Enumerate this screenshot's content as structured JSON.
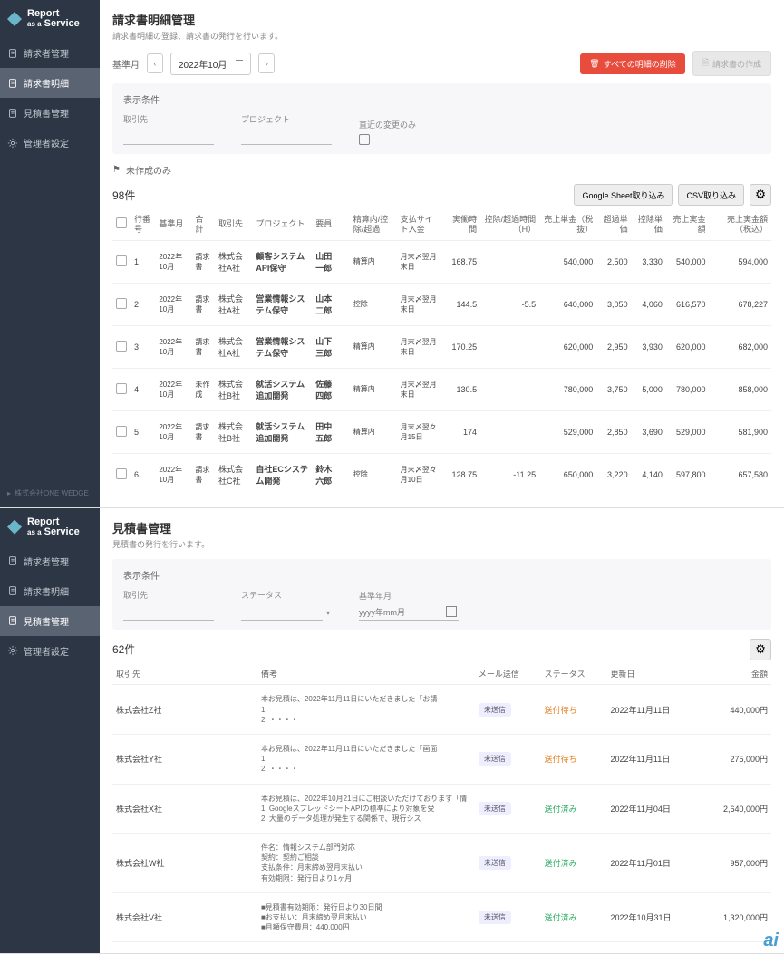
{
  "brand": {
    "line1": "Report",
    "line2": "as a",
    "line3": "Service"
  },
  "nav": [
    {
      "icon": "doc",
      "label": "請求者管理"
    },
    {
      "icon": "doc",
      "label": "請求書明細"
    },
    {
      "icon": "doc",
      "label": "見積書管理"
    },
    {
      "icon": "gear",
      "label": "管理者設定"
    }
  ],
  "footer_company": "株式会社ONE WEDGE",
  "screen1": {
    "title": "請求書明細管理",
    "subtitle": "請求書明細の登録、請求書の発行を行います。",
    "period_label": "基準月",
    "period_value": "2022年10月",
    "btn_delete_all": "すべての明細の削除",
    "btn_create": "請求書の作成",
    "filter_title": "表示条件",
    "filter_client": "取引先",
    "filter_project": "プロジェクト",
    "filter_changed": "直近の変更のみ",
    "flag_label": "未作成のみ",
    "count": "98件",
    "btn_gsheet": "Google Sheet取り込み",
    "btn_csv": "CSV取り込み",
    "columns": [
      "",
      "行番号",
      "基準月",
      "合計",
      "取引先",
      "プロジェクト",
      "要員",
      "精算内/控除/超過",
      "支払サイト入金",
      "実働時間",
      "控除/超過時間（H）",
      "売上単金（税抜）",
      "超過単価",
      "控除単価",
      "売上実金額",
      "売上実金額（税込）"
    ],
    "rows": [
      {
        "no": "1",
        "month": "2022年10月",
        "sum": "請求書",
        "client": "株式会社A社",
        "project": "顧客システムAPI保守",
        "member": "山田　一郎",
        "calc": "精算内",
        "site": "月末〆翌月末日",
        "hours": "168.75",
        "over": "",
        "unit": "540,000",
        "ou": "2,500",
        "du": "3,330",
        "amt": "540,000",
        "amt_tax": "594,000"
      },
      {
        "no": "2",
        "month": "2022年10月",
        "sum": "請求書",
        "client": "株式会社A社",
        "project": "営業情報システム保守",
        "member": "山本　二郎",
        "calc": "控除",
        "site": "月末〆翌月末日",
        "hours": "144.5",
        "over": "-5.5",
        "unit": "640,000",
        "ou": "3,050",
        "du": "4,060",
        "amt": "616,570",
        "amt_tax": "678,227"
      },
      {
        "no": "3",
        "month": "2022年10月",
        "sum": "請求書",
        "client": "株式会社A社",
        "project": "営業情報システム保守",
        "member": "山下　三郎",
        "calc": "精算内",
        "site": "月末〆翌月末日",
        "hours": "170.25",
        "over": "",
        "unit": "620,000",
        "ou": "2,950",
        "du": "3,930",
        "amt": "620,000",
        "amt_tax": "682,000"
      },
      {
        "no": "4",
        "month": "2022年10月",
        "sum": "未作成",
        "client": "株式会社B社",
        "project": "就活システム追加開発",
        "member": "佐藤　四郎",
        "calc": "精算内",
        "site": "月末〆翌月末日",
        "hours": "130.5",
        "over": "",
        "unit": "780,000",
        "ou": "3,750",
        "du": "5,000",
        "amt": "780,000",
        "amt_tax": "858,000"
      },
      {
        "no": "5",
        "month": "2022年10月",
        "sum": "請求書",
        "client": "株式会社B社",
        "project": "就活システム追加開発",
        "member": "田中　五郎",
        "calc": "精算内",
        "site": "月末〆翌々月15日",
        "hours": "174",
        "over": "",
        "unit": "529,000",
        "ou": "2,850",
        "du": "3,690",
        "amt": "529,000",
        "amt_tax": "581,900"
      },
      {
        "no": "6",
        "month": "2022年10月",
        "sum": "請求書",
        "client": "株式会社C社",
        "project": "自社ECシステム開発",
        "member": "鈴木　六郎",
        "calc": "控除",
        "site": "月末〆翌々月10日",
        "hours": "128.75",
        "over": "-11.25",
        "unit": "650,000",
        "ou": "3,220",
        "du": "4,140",
        "amt": "597,800",
        "amt_tax": "657,580"
      }
    ]
  },
  "screen2": {
    "title": "見積書管理",
    "subtitle": "見積書の発行を行います。",
    "filter_title": "表示条件",
    "filter_client": "取引先",
    "filter_status": "ステータス",
    "filter_base": "基準年月",
    "filter_base_ph": "yyyy年mm月",
    "count": "62件",
    "columns": [
      "取引先",
      "備考",
      "メール送信",
      "ステータス",
      "更新日",
      "金額"
    ],
    "rows": [
      {
        "client": "株式会社Z社",
        "memo": "本お見積は、2022年11月11日にいただきました「お請\n1.\n2. ・・・・",
        "mail": "未送信",
        "status": "送付待ち",
        "status_cls": "orange",
        "date": "2022年11月11日",
        "amount": "440,000円"
      },
      {
        "client": "株式会社Y社",
        "memo": "本お見積は、2022年11月11日にいただきました「画面\n1.\n2. ・・・・",
        "mail": "未送信",
        "status": "送付待ち",
        "status_cls": "orange",
        "date": "2022年11月11日",
        "amount": "275,000円"
      },
      {
        "client": "株式会社X社",
        "memo": "本お見積は、2022年10月21日にご相談いただけております「情\n1. GoogleスプレッドシートAPIの標準により対象を受\n2. 大量のデータ処理が発生する関係で、現行シス",
        "mail": "未送信",
        "status": "送付済み",
        "status_cls": "green",
        "date": "2022年11月04日",
        "amount": "2,640,000円"
      },
      {
        "client": "株式会社W社",
        "memo": "件名：情報システム部門対応\n契約：契約ご相談\n支払条件：月末締め翌月末払い\n有効期限：発行日より1ヶ月",
        "mail": "未送信",
        "status": "送付済み",
        "status_cls": "green",
        "date": "2022年11月01日",
        "amount": "957,000円"
      },
      {
        "client": "株式会社V社",
        "memo": "■見積書有効期限：発行日より30日間\n■お支払い：月末締め翌月末払い\n■月額保守費用：440,000円",
        "mail": "未送信",
        "status": "送付済み",
        "status_cls": "green",
        "date": "2022年10月31日",
        "amount": "1,320,000円"
      }
    ]
  }
}
